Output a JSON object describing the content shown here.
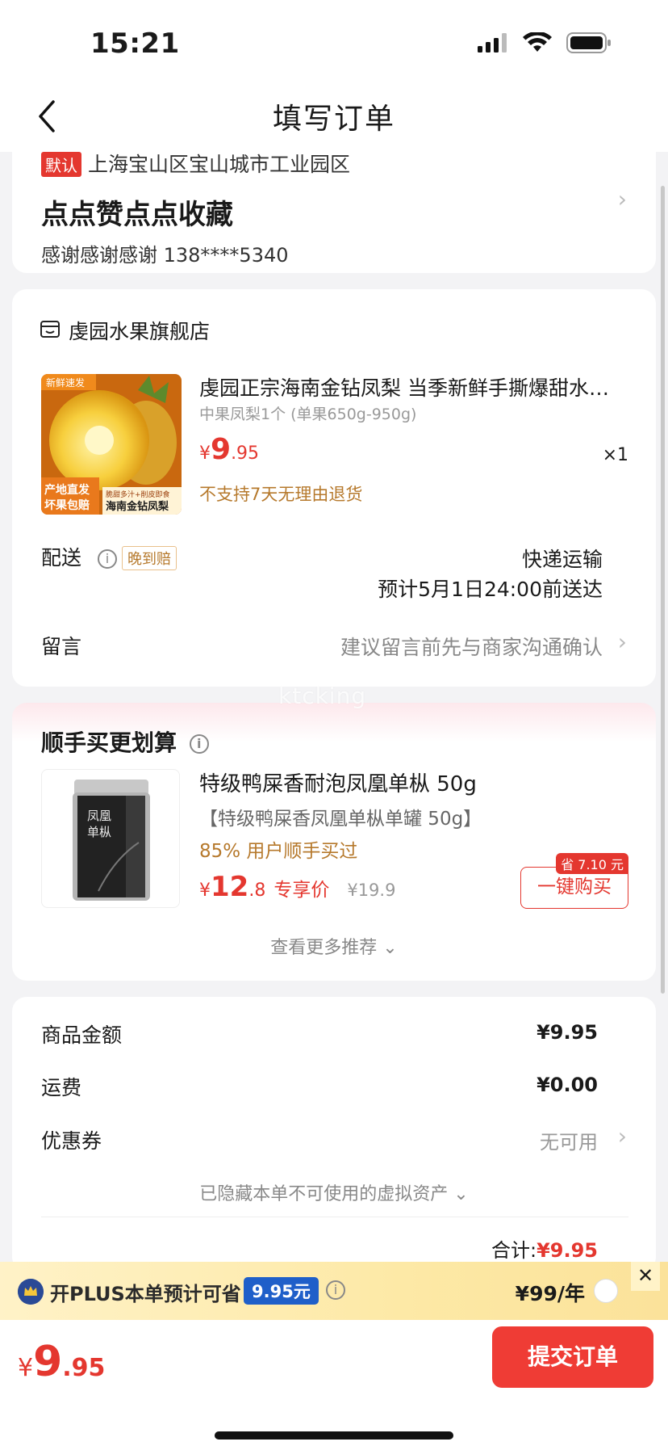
{
  "status_bar": {
    "time": "15:21"
  },
  "nav": {
    "title": "填写订单"
  },
  "address": {
    "default_tag": "默认",
    "location": "上海宝山区宝山城市工业园区",
    "name": "点点赞点点收藏",
    "contact": "感谢感谢感谢  138****5340"
  },
  "shop": {
    "name": "虔园水果旗舰店",
    "product": {
      "title": "虔园正宗海南金钻凤梨 当季新鲜手撕爆甜水…",
      "spec": "中果凤梨1个 (单果650g-950g)",
      "price_symbol": "¥",
      "price_int": "9",
      "price_dec": ".95",
      "qty": "×1",
      "return_note": "不支持7天无理由退货",
      "img_badge_top": "新鲜速发",
      "img_badge_left": "产地直发 坏果包赔",
      "img_badge_right_top": "脆甜多汁+削皮即食",
      "img_badge_right": "海南金钻凤梨"
    },
    "shipping_label": "配送",
    "late_tag": "晚到赔",
    "shipping_method": "快递运输",
    "shipping_eta": "预计5月1日24:00前送达",
    "message_label": "留言",
    "message_hint": "建议留言前先与商家沟通确认"
  },
  "watermark": "ktcking",
  "recommend": {
    "title": "顺手买更划算",
    "name": "特级鸭屎香耐泡凤凰单枞 50g",
    "desc": "【特级鸭屎香凤凰单枞单罐 50g】",
    "stat": "85% 用户顺手买过",
    "price_symbol": "¥",
    "price_int": "12",
    "price_dec": ".8",
    "exclusive": "专享价",
    "orig_price": "¥19.9",
    "save_tag": "省 7.10 元",
    "buy_label": "一键购买",
    "more": "查看更多推荐 ⌄",
    "img_text": "凤凰单枞"
  },
  "summary": {
    "goods_label": "商品金额",
    "goods_value": "¥9.95",
    "freight_label": "运费",
    "freight_value": "¥0.00",
    "coupon_label": "优惠券",
    "coupon_value": "无可用",
    "hidden_assets": "已隐藏本单不可使用的虚拟资产 ⌄",
    "total_label": "合计:",
    "total_value": "¥9.95"
  },
  "plus": {
    "text": "开PLUS本单预计可省",
    "badge": "9.95元",
    "price": "¥99/年",
    "close": "✕"
  },
  "bottom": {
    "price_symbol": "¥",
    "price_int": "9",
    "price_dec": ".95",
    "submit": "提交订单"
  },
  "colors": {
    "accent": "#e4372f",
    "gold": "#b6792c",
    "plus_blue": "#1f5fc9"
  }
}
